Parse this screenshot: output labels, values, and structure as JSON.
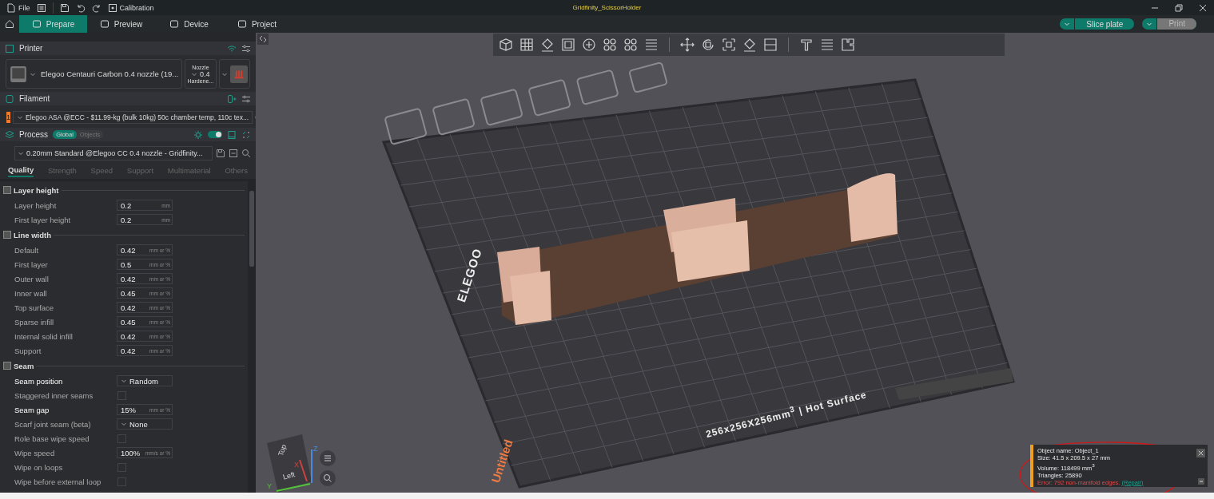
{
  "title_bar": {
    "menu": "File",
    "calibration": "Calibration",
    "document": "Gridfinity_ScissorHolder"
  },
  "tabs": [
    {
      "label": "Prepare",
      "selected": true
    },
    {
      "label": "Preview",
      "selected": false
    },
    {
      "label": "Device",
      "selected": false
    },
    {
      "label": "Project",
      "selected": false
    }
  ],
  "actions": [
    {
      "label": "Slice plate",
      "disabled": false
    },
    {
      "label": "Print",
      "disabled": true
    }
  ],
  "printer": {
    "title": "Printer",
    "name": "Elegoo Centauri Carbon 0.4 nozzle (19...",
    "nozzle_label": "Nozzle",
    "nozzle": "0.4",
    "nozzle_type": "Hardene..."
  },
  "filament": {
    "title": "Filament",
    "items": [
      {
        "index": "1",
        "color": "#f07a28",
        "name": "Elegoo ASA @ECC - $11.99-kg (bulk 10kg) 50c chamber temp, 110c tex..."
      }
    ]
  },
  "process": {
    "title": "Process",
    "switch_on": true,
    "scope": [
      {
        "label": "Global",
        "selected": true
      },
      {
        "label": "Objects",
        "selected": false
      }
    ],
    "preset": "0.20mm Standard @Elegoo CC 0.4 nozzle - Gridfinity..."
  },
  "setting_tabs": [
    {
      "label": "Quality",
      "selected": true
    },
    {
      "label": "Strength",
      "selected": false
    },
    {
      "label": "Speed",
      "selected": false
    },
    {
      "label": "Support",
      "selected": false
    },
    {
      "label": "Multimaterial",
      "selected": false
    },
    {
      "label": "Others",
      "selected": false
    }
  ],
  "groups": [
    {
      "title": "Layer height",
      "rows": [
        {
          "label": "Layer height",
          "kind": "input",
          "value": "0.2",
          "unit": "mm",
          "customized": false
        },
        {
          "label": "First layer height",
          "kind": "input",
          "value": "0.2",
          "unit": "mm",
          "customized": false
        }
      ]
    },
    {
      "title": "Line width",
      "rows": [
        {
          "label": "Default",
          "kind": "input",
          "value": "0.42",
          "unit": "mm or %",
          "customized": false
        },
        {
          "label": "First layer",
          "kind": "input",
          "value": "0.5",
          "unit": "mm or %",
          "customized": false
        },
        {
          "label": "Outer wall",
          "kind": "input",
          "value": "0.42",
          "unit": "mm or %",
          "customized": false
        },
        {
          "label": "Inner wall",
          "kind": "input",
          "value": "0.45",
          "unit": "mm or %",
          "customized": false
        },
        {
          "label": "Top surface",
          "kind": "input",
          "value": "0.42",
          "unit": "mm or %",
          "customized": false
        },
        {
          "label": "Sparse infill",
          "kind": "input",
          "value": "0.45",
          "unit": "mm or %",
          "customized": false
        },
        {
          "label": "Internal solid infill",
          "kind": "input",
          "value": "0.42",
          "unit": "mm or %",
          "customized": false
        },
        {
          "label": "Support",
          "kind": "input",
          "value": "0.42",
          "unit": "mm or %",
          "customized": false
        }
      ]
    },
    {
      "title": "Seam",
      "rows": [
        {
          "label": "Seam position",
          "kind": "dropdown",
          "value": "Random",
          "customized": true
        },
        {
          "label": "Staggered inner seams",
          "kind": "checkbox",
          "checked": false,
          "customized": false
        },
        {
          "label": "Seam gap",
          "kind": "input",
          "value": "15%",
          "unit": "mm or %",
          "customized": true
        },
        {
          "label": "Scarf joint seam (beta)",
          "kind": "dropdown",
          "value": "None",
          "customized": false
        },
        {
          "label": "Role base wipe speed",
          "kind": "checkbox",
          "checked": false,
          "customized": false
        },
        {
          "label": "Wipe speed",
          "kind": "input",
          "value": "100%",
          "unit": "mm/s or %",
          "customized": false
        },
        {
          "label": "Wipe on loops",
          "kind": "checkbox",
          "checked": false,
          "customized": false
        },
        {
          "label": "Wipe before external loop",
          "kind": "checkbox",
          "checked": false,
          "customized": false
        }
      ]
    }
  ],
  "viewport": {
    "plate_brand": "ELEGOO",
    "plate_size": "256x256X256mm$^{3}$ | Hot Surface",
    "plate_name": "Untitled",
    "cube_faces": [
      "Top",
      "Left"
    ],
    "axes": [
      "X",
      "Y",
      "Z"
    ]
  },
  "object_info": {
    "lines": [
      "Object name: Object_1",
      "Size: 41.5 x 209.5 x 27 mm",
      "Volume: 118499 mm$^{3}$",
      "Triangles: 25890"
    ],
    "error": "Error: 792 non-manifold edges.",
    "repair": "(Repair)"
  }
}
